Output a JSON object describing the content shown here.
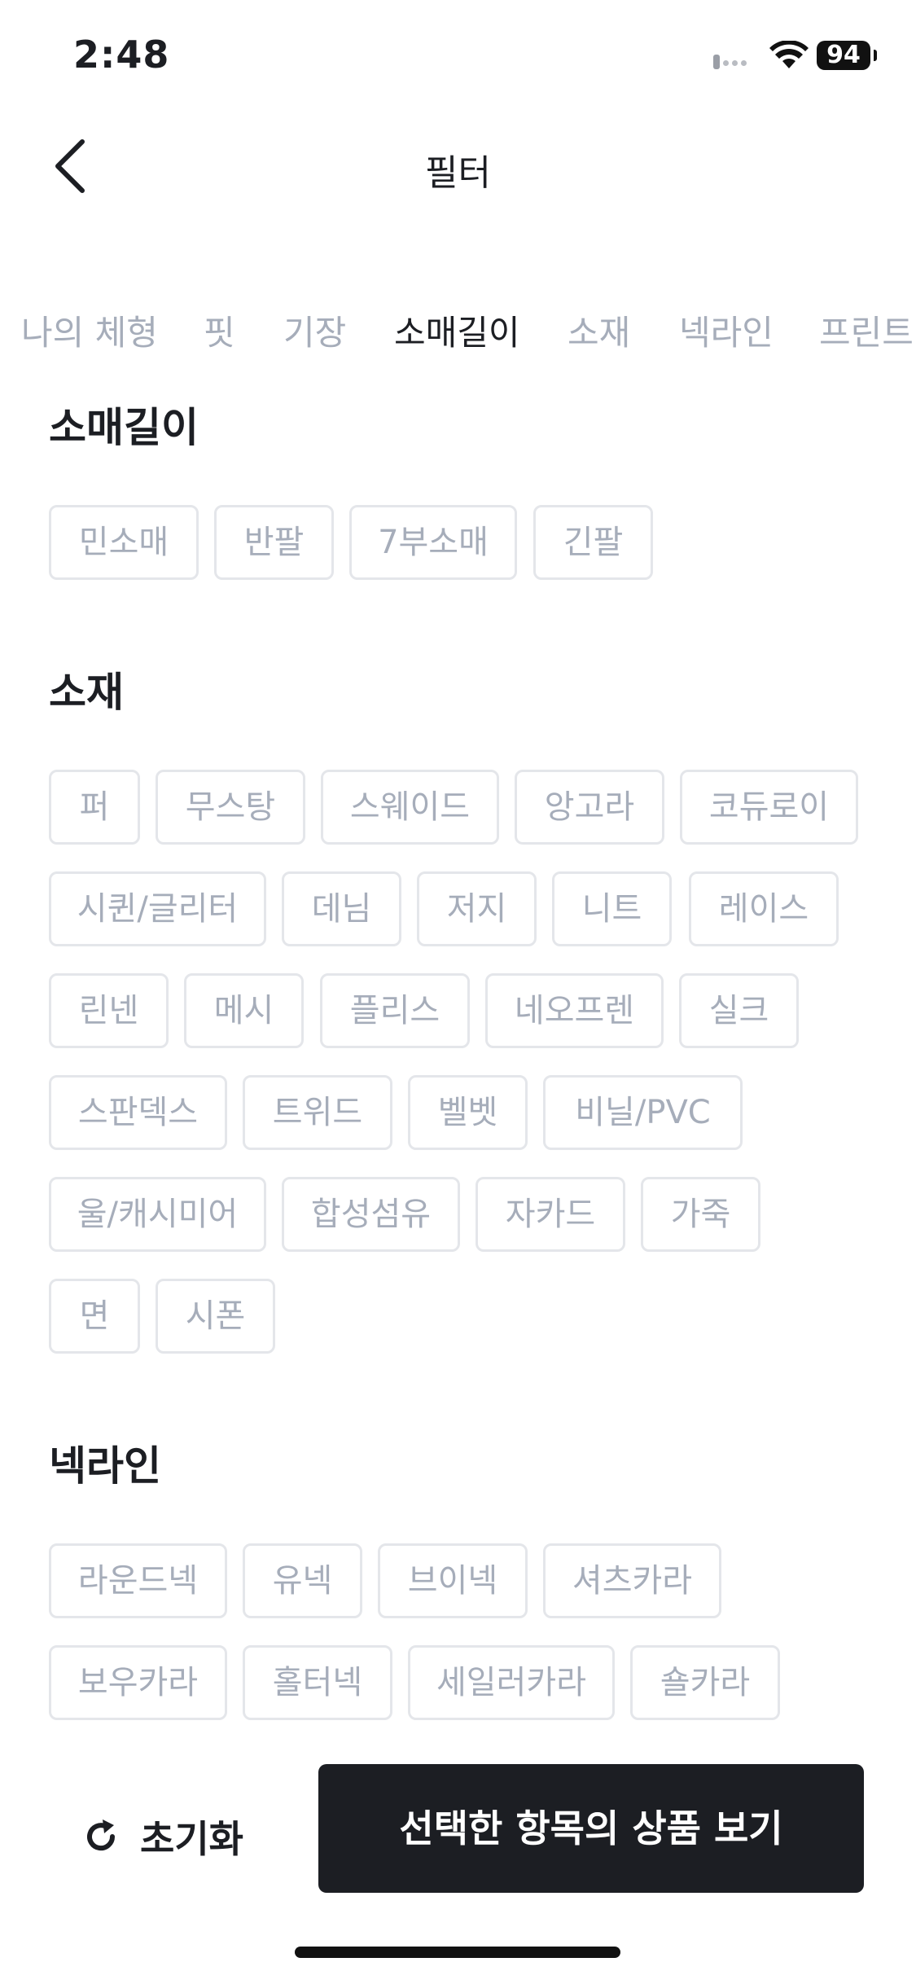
{
  "status": {
    "time": "2:48",
    "battery": "94"
  },
  "header": {
    "title": "필터"
  },
  "tabs": [
    {
      "label": "나의 체형"
    },
    {
      "label": "핏"
    },
    {
      "label": "기장"
    },
    {
      "label": "소매길이"
    },
    {
      "label": "소재"
    },
    {
      "label": "넥라인"
    },
    {
      "label": "프린트"
    }
  ],
  "active_tab": "소매길이",
  "sections": [
    {
      "title": "소매길이",
      "options": [
        "민소매",
        "반팔",
        "7부소매",
        "긴팔"
      ]
    },
    {
      "title": "소재",
      "options": [
        "퍼",
        "무스탕",
        "스웨이드",
        "앙고라",
        "코듀로이",
        "시퀸/글리터",
        "데님",
        "저지",
        "니트",
        "레이스",
        "린넨",
        "메시",
        "플리스",
        "네오프렌",
        "실크",
        "스판덱스",
        "트위드",
        "벨벳",
        "비닐/PVC",
        "울/캐시미어",
        "합성섬유",
        "자카드",
        "가죽",
        "면",
        "시폰"
      ]
    },
    {
      "title": "넥라인",
      "options": [
        "라운드넥",
        "유넥",
        "브이넥",
        "셔츠카라",
        "보우카라",
        "홀터넥",
        "세일러카라",
        "숄카라"
      ]
    }
  ],
  "footer": {
    "reset_label": "초기화",
    "submit_label": "선택한 항목의 상품 보기"
  },
  "colors": {
    "accent": "#1c1e23",
    "chip_border": "#e4e6ea",
    "chip_text": "#a6adba",
    "background": "#ffffff"
  }
}
